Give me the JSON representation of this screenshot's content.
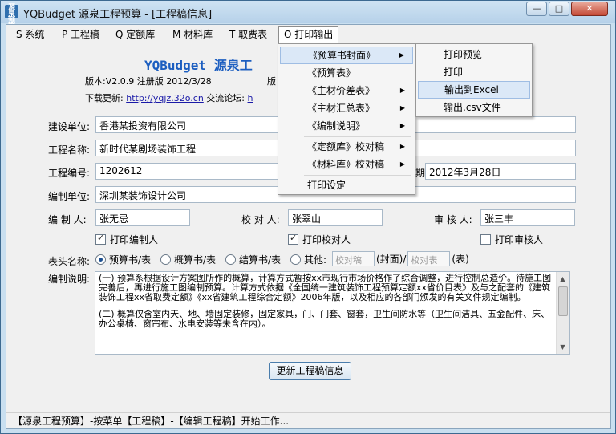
{
  "window": {
    "title": "YQBudget 源泉工程预算 - [工程稿信息]",
    "app_icon_text": "源泉预算",
    "min_glyph": "—",
    "max_glyph": "□",
    "close_glyph": "✕"
  },
  "menubar": {
    "items": [
      "S 系统",
      "P 工程稿",
      "Q 定额库",
      "M 材料库",
      "T 取费表",
      "O 打印输出"
    ],
    "active_index": 5
  },
  "header": {
    "title": "YQBudget 源泉工",
    "version_text": "版本:V2.0.9  注册版  2012/3/28",
    "version_suffix": "版",
    "download_label": "下载更新:",
    "download_link": "http://yqjz.32o.cn",
    "forum_label": "交流论坛:",
    "forum_link": "h"
  },
  "form": {
    "builder_label": "建设单位:",
    "builder_value": "香港某投资有限公司",
    "project_label": "工程名称:",
    "project_value": "新时代某剧场装饰工程",
    "code_label": "工程编号:",
    "code_value": "1202612",
    "date_label": "期:",
    "date_value": "2012年3月28日",
    "org_label": "编制单位:",
    "org_value": "深圳某装饰设计公司",
    "author_label": "编 制 人:",
    "author_value": "张无忌",
    "checker_label": "校 对 人:",
    "checker_value": "张翠山",
    "reviewer_label": "审 核 人:",
    "reviewer_value": "张三丰",
    "print_author_label": "打印编制人",
    "print_author_checked": true,
    "print_checker_label": "打印校对人",
    "print_checker_checked": true,
    "print_reviewer_label": "打印审核人",
    "print_reviewer_checked": false,
    "header_name_label": "表头名称:",
    "radio_options": [
      "预算书/表",
      "概算书/表",
      "结算书/表",
      "其他:"
    ],
    "radio_selected": 0,
    "other_placeholder1": "校对稿",
    "cover_text": "(封面)/",
    "other_placeholder2": "校对表",
    "table_text": "(表)",
    "notes_label": "编制说明:",
    "notes": [
      "(一) 预算系根据设计方案图所作的概算，计算方式暂按xx市现行市场价格作了综合调整，进行控制总造价。待施工图完善后，再进行施工图编制预算。计算方式依据《全国统一建筑装饰工程预算定额xx省价目表》及与之配套的《建筑装饰工程xx省取费定额》《xx省建筑工程综合定额》2006年版，以及相应的各部门颁发的有关文件规定编制。",
      "(二) 概算仅含室内天、地、墙固定装修，固定家具，门、门套、窗套，卫生间防水等（卫生间洁具、五金配件、床、办公桌椅、窗帘布、水电安装等未含在内）。"
    ],
    "update_button": "更新工程稿信息"
  },
  "dropdown": {
    "items": [
      "《预算书封面》",
      "《预算表》",
      "《主材价差表》",
      "《主材汇总表》",
      "《编制说明》",
      "《定额库》校对稿",
      "《材料库》校对稿",
      "打印设定"
    ],
    "arrow": "▶"
  },
  "submenu": {
    "items": [
      "打印预览",
      "打印",
      "输出到Excel",
      "输出.csv文件"
    ]
  },
  "statusbar": {
    "text": "【源泉工程预算】-按菜单【工程稿】-【编辑工程稿】开始工作..."
  }
}
